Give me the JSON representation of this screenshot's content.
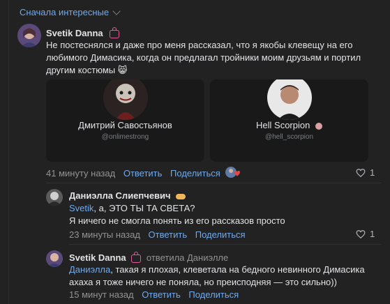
{
  "sort": {
    "label": "Сначала интересные"
  },
  "comments": [
    {
      "author": "Svetik Danna",
      "text": "Не постеснялся и даже про меня рассказал, что я якобы клевещу на его любимого Димасика, когда он предлагал тройники моим друзьям и портил другим костюмы",
      "emoji": "😸",
      "cards": [
        {
          "name": "Дмитрий Савостьянов",
          "handle": "@onlimestrong"
        },
        {
          "name": "Hell Scorpion",
          "handle": "@hell_scorpion"
        }
      ],
      "time": "41 минуту назад",
      "reply": "Ответить",
      "share": "Поделиться",
      "likes": "1"
    }
  ],
  "replies": [
    {
      "author": "Даниэлла Слиепчевич",
      "mention": "Svetik",
      "line1": ", а, ЭТО ТЫ ТА СВЕТА?",
      "line2": "Я ничего не смогла понять из его рассказов просто",
      "time": "23 минуты назад",
      "reply": "Ответить",
      "share": "Поделиться",
      "likes": "1"
    },
    {
      "author": "Svetik Danna",
      "answered": "ответила Даниэлле",
      "mention": "Даниэлла",
      "line1": ", такая я плохая, клеветала на бедного невинного Димасика",
      "line2": "ахаха я тоже ничего не поняла, но преисподняя — это сильно))",
      "time": "15 минут назад",
      "reply": "Ответить",
      "share": "Поделиться"
    }
  ],
  "colors": {
    "accent": "#71aaeb",
    "background": "#222222",
    "text": "#e1e3e6",
    "muted": "#939393",
    "badge": "#e05a9e"
  }
}
